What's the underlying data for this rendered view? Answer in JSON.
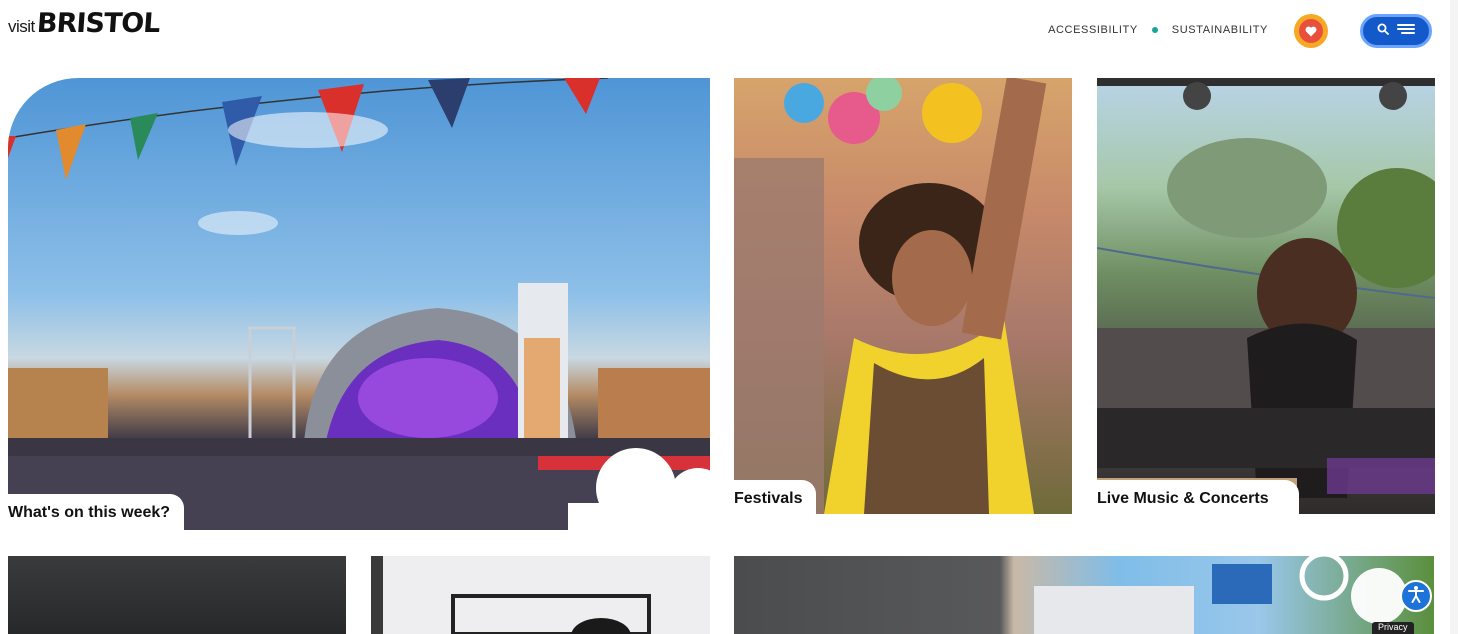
{
  "header": {
    "logo_visit": "visit",
    "logo_brand": "BRISTOL",
    "nav": [
      {
        "label": "ACCESSIBILITY"
      },
      {
        "label": "SUSTAINABILITY"
      }
    ],
    "favourites_icon": "heart-icon",
    "menu_icons": [
      "search-icon",
      "menu-lines-icon"
    ]
  },
  "cards": {
    "whats_on": {
      "label": "What's on this week?"
    },
    "festivals": {
      "label": "Festivals"
    },
    "live_music": {
      "label": "Live Music & Concerts"
    }
  },
  "widgets": {
    "accessibility_icon": "accessibility-person-icon",
    "privacy_label": "Privacy"
  },
  "colors": {
    "nav_dot": "#1aa39a",
    "fav_outer": "#f7a824",
    "fav_inner": "#e94f3d",
    "menu_button": "#1359c9"
  }
}
